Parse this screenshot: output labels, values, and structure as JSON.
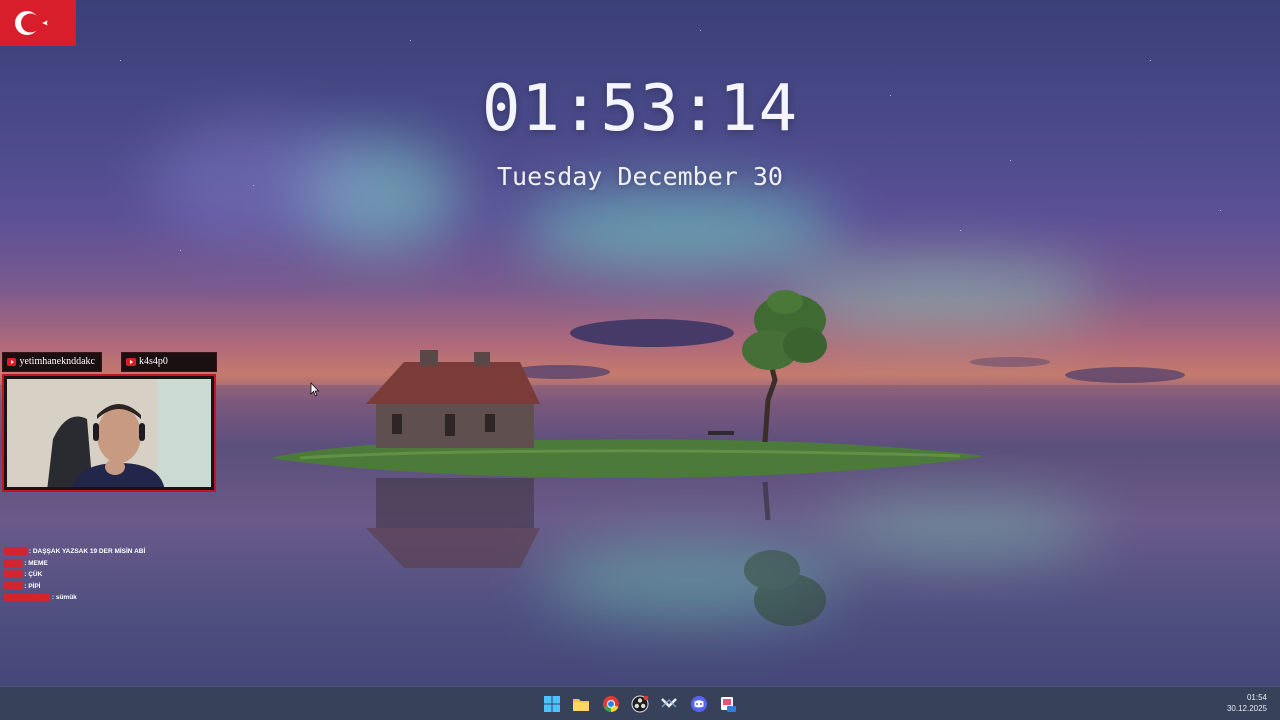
{
  "wallpaper": {
    "theme": "lake-island-aurora"
  },
  "clock": {
    "time": "01:53:14",
    "date": "Tuesday December 30"
  },
  "flag": {
    "name": "turkey-flag-icon",
    "color": "#d81e2a"
  },
  "stream": {
    "channels": [
      "yetimhaneknddakc",
      "k4s4p0"
    ],
    "chat": [
      {
        "user": "█████",
        "message": "DAŞŞAK YAZSAK 19 DER MİSİN ABİ"
      },
      {
        "user": "████",
        "message": "MEME"
      },
      {
        "user": "████",
        "message": "ÇÜK"
      },
      {
        "user": "████",
        "message": "PİPİ"
      },
      {
        "user": "██████████",
        "message": "sümük"
      }
    ]
  },
  "taskbar": {
    "apps": [
      {
        "name": "start-icon"
      },
      {
        "name": "file-explorer-icon"
      },
      {
        "name": "chrome-icon"
      },
      {
        "name": "obs-icon"
      },
      {
        "name": "steam-icon"
      },
      {
        "name": "discord-icon"
      },
      {
        "name": "snipping-tool-icon"
      }
    ],
    "time": "01:54",
    "date": "30.12.2025"
  },
  "colors": {
    "accent": "#c2161f",
    "taskbar": "#37415a"
  }
}
